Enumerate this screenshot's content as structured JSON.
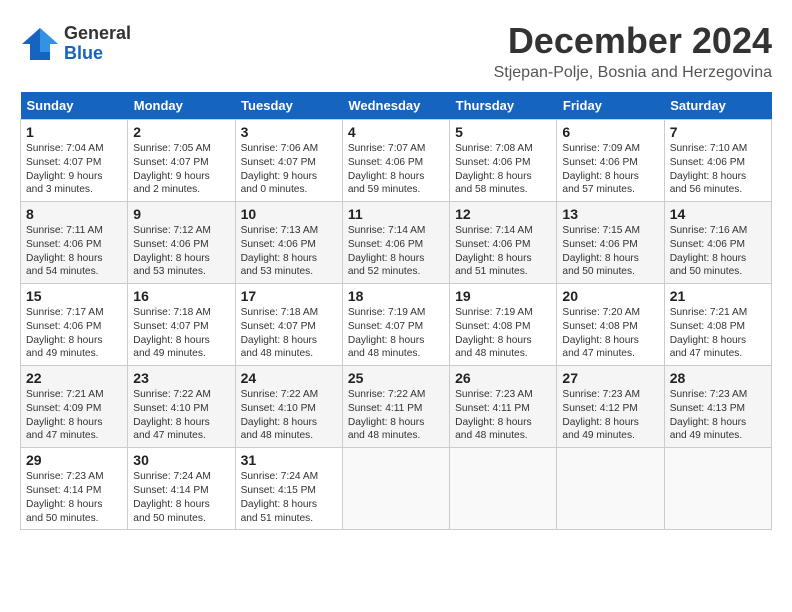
{
  "logo": {
    "general": "General",
    "blue": "Blue"
  },
  "title": "December 2024",
  "subtitle": "Stjepan-Polje, Bosnia and Herzegovina",
  "days_of_week": [
    "Sunday",
    "Monday",
    "Tuesday",
    "Wednesday",
    "Thursday",
    "Friday",
    "Saturday"
  ],
  "weeks": [
    [
      {
        "day": "1",
        "info": "Sunrise: 7:04 AM\nSunset: 4:07 PM\nDaylight: 9 hours\nand 3 minutes."
      },
      {
        "day": "2",
        "info": "Sunrise: 7:05 AM\nSunset: 4:07 PM\nDaylight: 9 hours\nand 2 minutes."
      },
      {
        "day": "3",
        "info": "Sunrise: 7:06 AM\nSunset: 4:07 PM\nDaylight: 9 hours\nand 0 minutes."
      },
      {
        "day": "4",
        "info": "Sunrise: 7:07 AM\nSunset: 4:06 PM\nDaylight: 8 hours\nand 59 minutes."
      },
      {
        "day": "5",
        "info": "Sunrise: 7:08 AM\nSunset: 4:06 PM\nDaylight: 8 hours\nand 58 minutes."
      },
      {
        "day": "6",
        "info": "Sunrise: 7:09 AM\nSunset: 4:06 PM\nDaylight: 8 hours\nand 57 minutes."
      },
      {
        "day": "7",
        "info": "Sunrise: 7:10 AM\nSunset: 4:06 PM\nDaylight: 8 hours\nand 56 minutes."
      }
    ],
    [
      {
        "day": "8",
        "info": "Sunrise: 7:11 AM\nSunset: 4:06 PM\nDaylight: 8 hours\nand 54 minutes."
      },
      {
        "day": "9",
        "info": "Sunrise: 7:12 AM\nSunset: 4:06 PM\nDaylight: 8 hours\nand 53 minutes."
      },
      {
        "day": "10",
        "info": "Sunrise: 7:13 AM\nSunset: 4:06 PM\nDaylight: 8 hours\nand 53 minutes."
      },
      {
        "day": "11",
        "info": "Sunrise: 7:14 AM\nSunset: 4:06 PM\nDaylight: 8 hours\nand 52 minutes."
      },
      {
        "day": "12",
        "info": "Sunrise: 7:14 AM\nSunset: 4:06 PM\nDaylight: 8 hours\nand 51 minutes."
      },
      {
        "day": "13",
        "info": "Sunrise: 7:15 AM\nSunset: 4:06 PM\nDaylight: 8 hours\nand 50 minutes."
      },
      {
        "day": "14",
        "info": "Sunrise: 7:16 AM\nSunset: 4:06 PM\nDaylight: 8 hours\nand 50 minutes."
      }
    ],
    [
      {
        "day": "15",
        "info": "Sunrise: 7:17 AM\nSunset: 4:06 PM\nDaylight: 8 hours\nand 49 minutes."
      },
      {
        "day": "16",
        "info": "Sunrise: 7:18 AM\nSunset: 4:07 PM\nDaylight: 8 hours\nand 49 minutes."
      },
      {
        "day": "17",
        "info": "Sunrise: 7:18 AM\nSunset: 4:07 PM\nDaylight: 8 hours\nand 48 minutes."
      },
      {
        "day": "18",
        "info": "Sunrise: 7:19 AM\nSunset: 4:07 PM\nDaylight: 8 hours\nand 48 minutes."
      },
      {
        "day": "19",
        "info": "Sunrise: 7:19 AM\nSunset: 4:08 PM\nDaylight: 8 hours\nand 48 minutes."
      },
      {
        "day": "20",
        "info": "Sunrise: 7:20 AM\nSunset: 4:08 PM\nDaylight: 8 hours\nand 47 minutes."
      },
      {
        "day": "21",
        "info": "Sunrise: 7:21 AM\nSunset: 4:08 PM\nDaylight: 8 hours\nand 47 minutes."
      }
    ],
    [
      {
        "day": "22",
        "info": "Sunrise: 7:21 AM\nSunset: 4:09 PM\nDaylight: 8 hours\nand 47 minutes."
      },
      {
        "day": "23",
        "info": "Sunrise: 7:22 AM\nSunset: 4:10 PM\nDaylight: 8 hours\nand 47 minutes."
      },
      {
        "day": "24",
        "info": "Sunrise: 7:22 AM\nSunset: 4:10 PM\nDaylight: 8 hours\nand 48 minutes."
      },
      {
        "day": "25",
        "info": "Sunrise: 7:22 AM\nSunset: 4:11 PM\nDaylight: 8 hours\nand 48 minutes."
      },
      {
        "day": "26",
        "info": "Sunrise: 7:23 AM\nSunset: 4:11 PM\nDaylight: 8 hours\nand 48 minutes."
      },
      {
        "day": "27",
        "info": "Sunrise: 7:23 AM\nSunset: 4:12 PM\nDaylight: 8 hours\nand 49 minutes."
      },
      {
        "day": "28",
        "info": "Sunrise: 7:23 AM\nSunset: 4:13 PM\nDaylight: 8 hours\nand 49 minutes."
      }
    ],
    [
      {
        "day": "29",
        "info": "Sunrise: 7:23 AM\nSunset: 4:14 PM\nDaylight: 8 hours\nand 50 minutes."
      },
      {
        "day": "30",
        "info": "Sunrise: 7:24 AM\nSunset: 4:14 PM\nDaylight: 8 hours\nand 50 minutes."
      },
      {
        "day": "31",
        "info": "Sunrise: 7:24 AM\nSunset: 4:15 PM\nDaylight: 8 hours\nand 51 minutes."
      },
      {
        "day": "",
        "info": ""
      },
      {
        "day": "",
        "info": ""
      },
      {
        "day": "",
        "info": ""
      },
      {
        "day": "",
        "info": ""
      }
    ]
  ]
}
